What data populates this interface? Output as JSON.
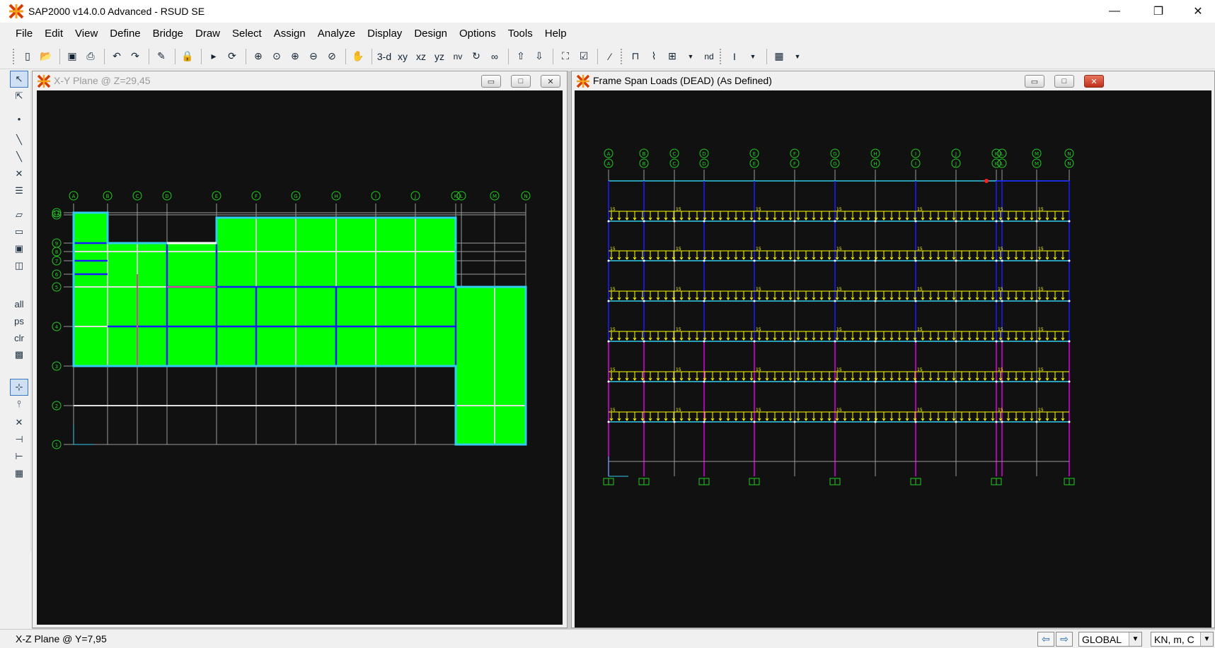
{
  "app": {
    "title": "SAP2000 v14.0.0 Advanced  - RSUD SE",
    "window_controls": {
      "minimize": "—",
      "restore": "❐",
      "close": "✕"
    }
  },
  "menu": [
    "File",
    "Edit",
    "View",
    "Define",
    "Bridge",
    "Draw",
    "Select",
    "Assign",
    "Analyze",
    "Display",
    "Design",
    "Options",
    "Tools",
    "Help"
  ],
  "toolbar": {
    "view_3d": "3-d",
    "view_xy": "xy",
    "view_xz": "xz",
    "view_yz": "yz",
    "view_nv": "nv",
    "nd": "nd"
  },
  "left_toolbar": {
    "all": "all",
    "ps": "ps",
    "clr": "clr"
  },
  "plan_window": {
    "title": "X-Y Plane @ Z=29,45",
    "active": false,
    "grid_x_labels": [
      "A",
      "B",
      "C",
      "D",
      "E",
      "F",
      "G",
      "H",
      "I",
      "J",
      "K",
      "L",
      "M",
      "N"
    ],
    "grid_y_labels": [
      "11",
      "10",
      "9",
      "8",
      "7",
      "6",
      "5",
      "4",
      "3",
      "2",
      "1"
    ]
  },
  "elev_window": {
    "title": "Frame Span Loads (DEAD) (As Defined)",
    "active": true,
    "grid_labels": [
      "A",
      "B",
      "C",
      "D",
      "E",
      "F",
      "G",
      "H",
      "I",
      "J",
      "K",
      "L",
      "M",
      "N"
    ],
    "load_value": "15"
  },
  "status": {
    "text": "X-Z Plane @ Y=7,95",
    "coord_system": "GLOBAL",
    "units": "KN, m, C"
  },
  "colors": {
    "canvas_bg": "#111111",
    "area_fill": "#00ff00",
    "beam_cyan": "#33ccee",
    "beam_blue": "#1a1aff",
    "grid": "#9a9a9a",
    "load": "#ffff00",
    "column_magenta": "#e000e0"
  }
}
